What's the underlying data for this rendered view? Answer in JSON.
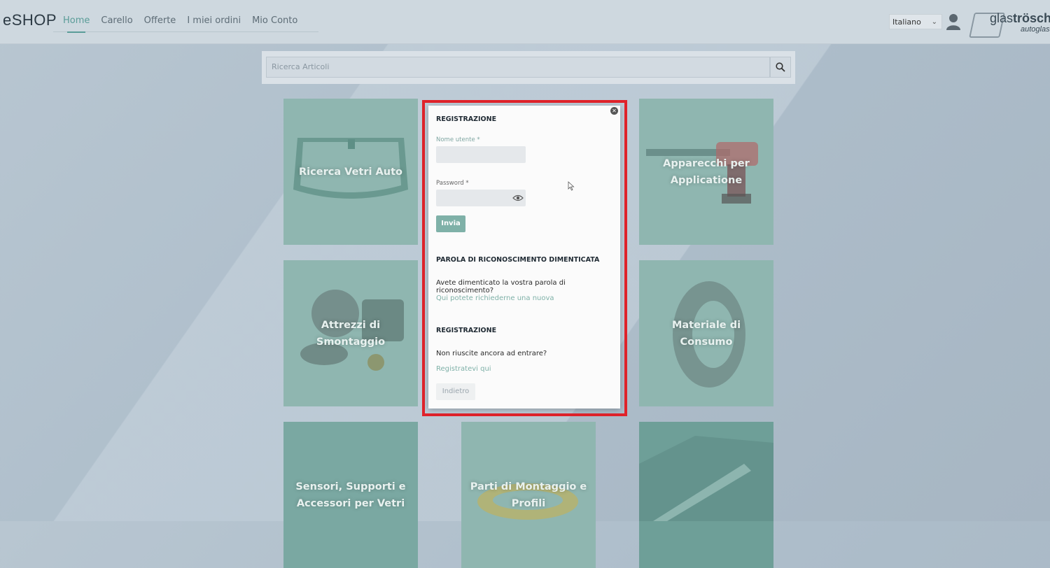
{
  "header": {
    "brand": "eSHOP",
    "nav": [
      "Home",
      "Carello",
      "Offerte",
      "I miei ordini",
      "Mio Conto"
    ],
    "language": "Italiano",
    "logo": {
      "glas": "glas",
      "trosch": "trösch",
      "sub": "autoglas"
    }
  },
  "search": {
    "placeholder": "Ricerca Articoli"
  },
  "tiles": [
    "Ricerca Vetri Auto",
    "Apparecchi per Applicatione",
    "Attrezzi di Smontaggio",
    "Materiale di Consumo",
    "Sensori, Supporti e Accessori per Vetri",
    "Parti di Montaggio e Profili",
    ""
  ],
  "modal": {
    "login_title": "REGISTRAZIONE",
    "username_label": "Nome utente *",
    "password_label": "Password *",
    "send_button": "Invia",
    "forgot_title": "PAROLA DI RICONOSCIMENTO DIMENTICATA",
    "forgot_text": "Avete dimenticato la vostra parola di riconoscimento?",
    "forgot_link": "Qui potete richiederne una nuova",
    "register_title": "REGISTRAZIONE",
    "register_text": "Non riuscite ancora ad entrare?",
    "register_link": "Registratevi qui",
    "back_button": "Indietro"
  },
  "colors": {
    "accent": "#7fb1a8",
    "highlight": "#e0232b",
    "tile": "#8fb6b0"
  }
}
